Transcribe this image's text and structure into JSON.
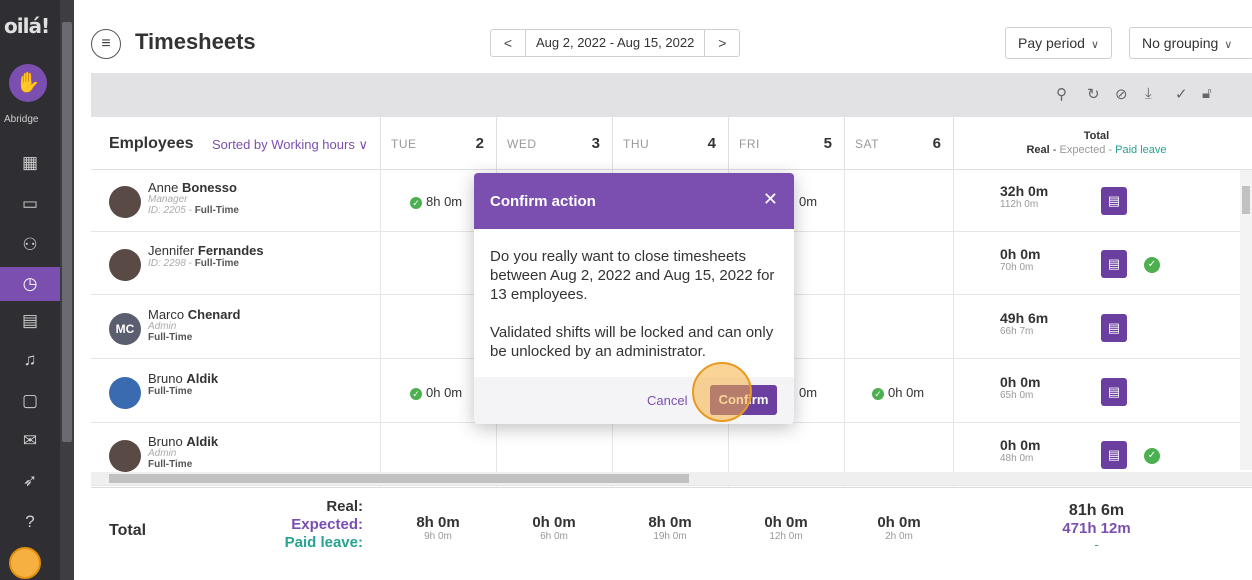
{
  "app": {
    "logo_text": "oilá!",
    "org_name": "Abridge"
  },
  "nav": [
    {
      "icon": "dashboard-icon",
      "glyph": "▦"
    },
    {
      "icon": "calendar-icon",
      "glyph": "▭"
    },
    {
      "icon": "employees-icon",
      "glyph": "⚇"
    },
    {
      "icon": "clock-icon",
      "glyph": "◷"
    },
    {
      "icon": "inbox-icon",
      "glyph": "▤"
    },
    {
      "icon": "bell-icon",
      "glyph": "♫"
    },
    {
      "icon": "chat-icon",
      "glyph": "▢"
    },
    {
      "icon": "megaphone-icon",
      "glyph": "✉"
    },
    {
      "icon": "rocket-icon",
      "glyph": "➶"
    },
    {
      "icon": "help-icon",
      "glyph": "?"
    }
  ],
  "header": {
    "title": "Timesheets",
    "date_range": "Aug 2, 2022 - Aug 15, 2022",
    "prev_glyph": "<",
    "next_glyph": ">",
    "period_select": "Pay period",
    "grouping_select": "No grouping"
  },
  "table": {
    "employees_label": "Employees",
    "sort_label": "Sorted by Working hours",
    "days": [
      {
        "name": "TUE",
        "num": "2"
      },
      {
        "name": "WED",
        "num": "3"
      },
      {
        "name": "THU",
        "num": "4"
      },
      {
        "name": "FRI",
        "num": "5"
      },
      {
        "name": "SAT",
        "num": "6"
      }
    ],
    "total_title": "Total",
    "total_real": "Real",
    "total_sep1": " - ",
    "total_expected": "Expected",
    "total_sep2": " - ",
    "total_paid": "Paid leave",
    "rows": [
      {
        "first": "Anne",
        "last": "Bonesso",
        "role": "Manager",
        "id": "ID: 2205",
        "contract": "Full-Time",
        "real": "32h 0m",
        "expected": "112h 0m",
        "tue": "8h 0m",
        "fri": "0m",
        "sat": "",
        "validated": false
      },
      {
        "first": "Jennifer",
        "last": "Fernandes",
        "role": "",
        "id": "ID: 2298",
        "contract": "Full-Time",
        "real": "0h 0m",
        "expected": "70h 0m",
        "tue": "",
        "fri": "",
        "sat": "",
        "validated": true
      },
      {
        "first": "Marco",
        "last": "Chenard",
        "role": "Admin",
        "id": "",
        "contract": "Full-Time",
        "initials": "MC",
        "real": "49h 6m",
        "expected": "66h 7m",
        "tue": "",
        "fri": "",
        "sat": "",
        "validated": false
      },
      {
        "first": "Bruno",
        "last": "Aldik",
        "role": "",
        "id": "",
        "contract": "Full-Time",
        "real": "0h 0m",
        "expected": "65h 0m",
        "tue": "0h 0m",
        "fri": "0m",
        "sat": "0h 0m",
        "validated": false
      },
      {
        "first": "Bruno",
        "last": "Aldik",
        "role": "Admin",
        "id": "",
        "contract": "Full-Time",
        "real": "0h 0m",
        "expected": "48h 0m",
        "tue": "",
        "fri": "",
        "sat": "",
        "validated": true
      }
    ]
  },
  "footer": {
    "label": "Total",
    "real_label": "Real:",
    "expected_label": "Expected:",
    "paid_label": "Paid leave:",
    "cells": [
      {
        "real": "8h 0m",
        "expected": "9h 0m"
      },
      {
        "real": "0h 0m",
        "expected": "6h 0m"
      },
      {
        "real": "8h 0m",
        "expected": "19h 0m"
      },
      {
        "real": "0h 0m",
        "expected": "12h 0m"
      },
      {
        "real": "0h 0m",
        "expected": "2h 0m"
      }
    ],
    "total_real": "81h 6m",
    "total_expected": "471h 12m",
    "total_paid": "-"
  },
  "modal": {
    "title": "Confirm action",
    "close_glyph": "✕",
    "body1": "Do you really want to close timesheets between Aug 2, 2022 and Aug 15, 2022 for 13 employees.",
    "body2": "Validated shifts will be locked and can only be unlocked by an administrator.",
    "cancel": "Cancel",
    "confirm": "Confirm"
  }
}
